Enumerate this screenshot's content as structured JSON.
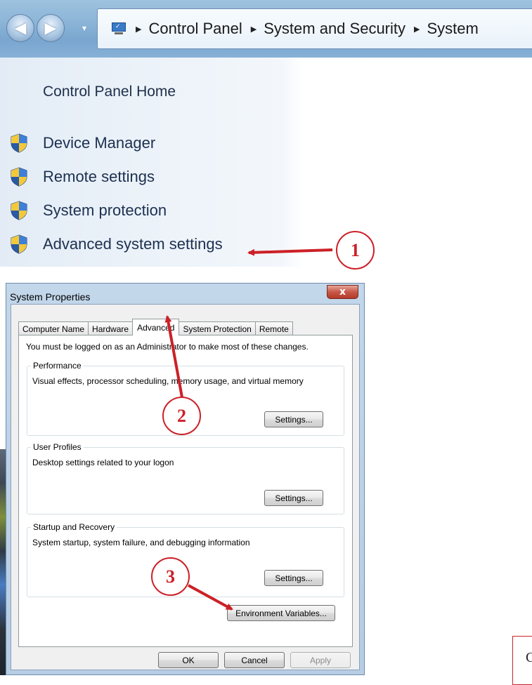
{
  "address_bar": {
    "back_icon": "◀",
    "forward_icon": "▶",
    "history_dropdown_icon": "▾",
    "breadcrumb_separator": "▶",
    "breadcrumbs": [
      "Control Panel",
      "System and Security",
      "System"
    ]
  },
  "task_pane": {
    "home_link": "Control Panel Home",
    "items": [
      {
        "label": "Device Manager",
        "icon": "uac-shield-icon"
      },
      {
        "label": "Remote settings",
        "icon": "uac-shield-icon"
      },
      {
        "label": "System protection",
        "icon": "uac-shield-icon"
      },
      {
        "label": "Advanced system settings",
        "icon": "uac-shield-icon"
      }
    ]
  },
  "dialog": {
    "title": "System Properties",
    "close_glyph": "x",
    "tabs": [
      "Computer Name",
      "Hardware",
      "Advanced",
      "System Protection",
      "Remote"
    ],
    "active_tab": "Advanced",
    "admin_note": "You must be logged on as an Administrator to make most of these changes.",
    "groups": {
      "performance": {
        "title": "Performance",
        "description": "Visual effects, processor scheduling, memory usage, and virtual memory",
        "button": "Settings..."
      },
      "user_profiles": {
        "title": "User Profiles",
        "description": "Desktop settings related to your logon",
        "button": "Settings..."
      },
      "startup_recovery": {
        "title": "Startup and Recovery",
        "description": "System startup, system failure, and debugging information",
        "button": "Settings..."
      }
    },
    "env_button": "Environment Variables...",
    "ok": "OK",
    "cancel": "Cancel",
    "apply": "Apply"
  },
  "annotations": {
    "step1": "1",
    "step2": "2",
    "step3": "3",
    "arrow_color": "#cc2027",
    "cropped_text": "C"
  }
}
